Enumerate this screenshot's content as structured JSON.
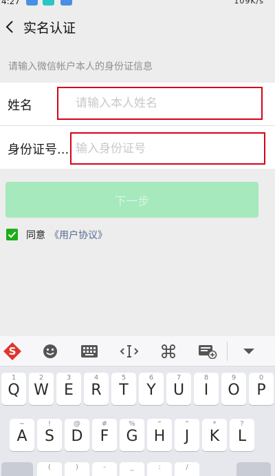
{
  "status_bar": {
    "time": "4:27",
    "system_text": "109K/s"
  },
  "nav": {
    "title": "实名认证"
  },
  "hint": "请输入微信帐户本人的身份证信息",
  "form": {
    "name_label": "姓名",
    "name_placeholder": "请输入本人姓名",
    "id_label": "身份证号...",
    "id_placeholder": "输入身份证号"
  },
  "next_button": "下一步",
  "agreement": {
    "prefix": "同意",
    "link": "《用户协议》",
    "checked": true
  },
  "colors": {
    "accent_green": "#1aad19",
    "disabled_button": "#a5e9bd",
    "highlight_red": "#d40018",
    "link_blue": "#576b95"
  },
  "keyboard": {
    "toolbar_icons": [
      "sogou-logo-icon",
      "emoji-icon",
      "keyboard-icon",
      "cursor-move-icon",
      "command-icon",
      "clipboard-add-icon",
      "collapse-keyboard-icon"
    ],
    "row1": [
      {
        "main": "Q",
        "sub": "1"
      },
      {
        "main": "W",
        "sub": "2"
      },
      {
        "main": "E",
        "sub": "3"
      },
      {
        "main": "R",
        "sub": "4"
      },
      {
        "main": "T",
        "sub": "5"
      },
      {
        "main": "Y",
        "sub": "6"
      },
      {
        "main": "U",
        "sub": "7"
      },
      {
        "main": "I",
        "sub": "8"
      },
      {
        "main": "O",
        "sub": "9"
      },
      {
        "main": "P",
        "sub": "0"
      }
    ],
    "row2": [
      {
        "main": "A",
        "sub": "~"
      },
      {
        "main": "S",
        "sub": "!"
      },
      {
        "main": "D",
        "sub": "@"
      },
      {
        "main": "F",
        "sub": "#"
      },
      {
        "main": "G",
        "sub": "%"
      },
      {
        "main": "H",
        "sub": "“"
      },
      {
        "main": "J",
        "sub": "”"
      },
      {
        "main": "K",
        "sub": "*"
      },
      {
        "main": "L",
        "sub": "?"
      }
    ],
    "row3_partial": [
      {
        "main": "",
        "sub": "("
      },
      {
        "main": "",
        "sub": ")"
      },
      {
        "main": "",
        "sub": "-"
      },
      {
        "main": "",
        "sub": "_"
      },
      {
        "main": "",
        "sub": ":"
      },
      {
        "main": "",
        "sub": "/"
      }
    ]
  }
}
